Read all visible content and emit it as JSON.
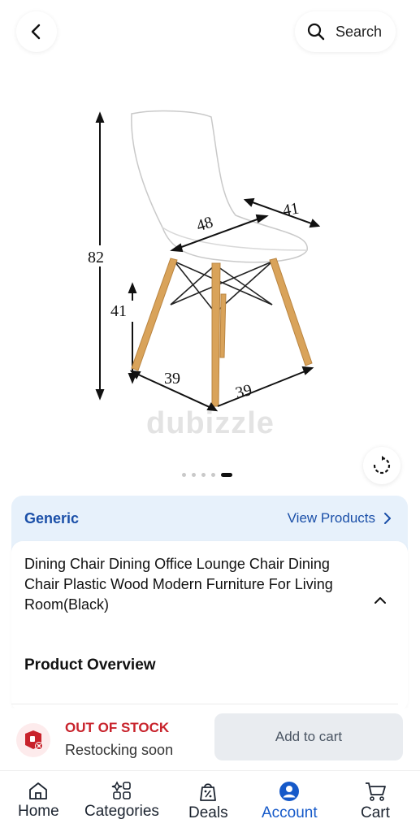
{
  "header": {
    "back_icon": "chevron-left-icon",
    "search_label": "Search",
    "search_icon": "search-icon"
  },
  "gallery": {
    "watermark": "dubizzle",
    "dimensions": {
      "height_total": "82",
      "seat_height": "41",
      "seat_width": "48",
      "seat_depth": "41",
      "base_left": "39",
      "base_right": "39"
    },
    "image_count": 5,
    "active_index": 4,
    "rotate_icon": "rotate-icon"
  },
  "brand": {
    "name": "Generic",
    "view_products_label": "View Products"
  },
  "product": {
    "title": "Dining Chair Dining Office Lounge Chair Dining Chair Plastic Wood Modern Furniture For Living Room(Black)",
    "overview_heading": "Product Overview"
  },
  "stock": {
    "status": "OUT OF STOCK",
    "subtext": "Restocking soon",
    "add_to_cart_label": "Add to cart"
  },
  "tabbar": {
    "items": [
      {
        "label": "Home",
        "icon": "home-icon"
      },
      {
        "label": "Categories",
        "icon": "categories-icon"
      },
      {
        "label": "Deals",
        "icon": "deals-icon"
      },
      {
        "label": "Account",
        "icon": "account-icon"
      },
      {
        "label": "Cart",
        "icon": "cart-icon"
      }
    ],
    "active_index": 3
  },
  "colors": {
    "brand_blue": "#1a4fa8",
    "active_tab": "#1559c9",
    "out_of_stock": "#c8232c",
    "brand_card_bg": "#e7f1fb"
  }
}
